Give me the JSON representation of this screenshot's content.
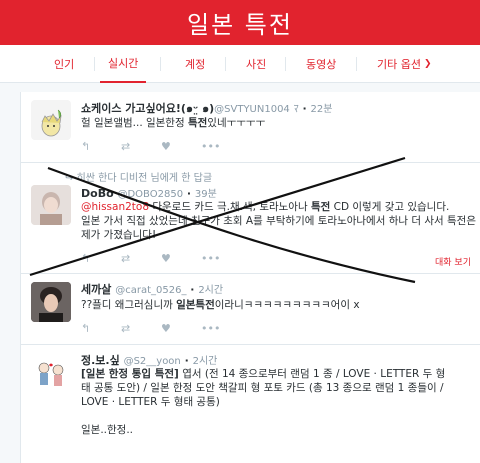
{
  "header": {
    "title": "일본 특전"
  },
  "tabs": [
    {
      "label": "인기"
    },
    {
      "label": "실시간"
    },
    {
      "label": "계정"
    },
    {
      "label": "사진"
    },
    {
      "label": "동영상"
    },
    {
      "label": "기타 옵션"
    }
  ],
  "tweets": [
    {
      "name": "쇼케이스 가고싶어요!(๑ᵕ̤ ๑)",
      "handle": "@SVTYUN1004",
      "suffix": "ﾏ",
      "time": "22분",
      "text_parts": [
        "헐 일본앨범... 일본한정 ",
        "특전",
        "있네ㅜㅜㅜㅜ"
      ]
    },
    {
      "context": "히싼 한다 디비전 님에게 한 답글",
      "name": "DoBo",
      "handle": "@DOBO2850",
      "time": "39분",
      "mention": "@hissan2to8",
      "text_rest_1": " 다운로드 카드 극.채.색, 토라노아나 ",
      "text_bold": "특전",
      "text_rest_2": " CD 이렇게 갖고 있습니다.",
      "text_line2": "일본 가서 직접 샀었는데 친구가 초회 A를 부탁하기에 토라노아나에서 하나 더 사서 특전은 제가 가졌습니다!",
      "conversation_link": "대화 보기"
    },
    {
      "name": "세까살",
      "handle": "@carat_0526_",
      "time": "2시간",
      "text_parts": [
        "??플디 왜그러심니까 ",
        "일본특전",
        "이라니ㅋㅋㅋㅋㅋㅋㅋㅋㅋ어이 x"
      ]
    },
    {
      "name": "정.보.싶",
      "handle": "@S2__yoon",
      "time": "2시간",
      "line1_bold": "[일본 한정 통입 특전]",
      "line1_rest": " 엽서 (전 14 종으로부터 랜덤 1 종 / LOVE · LETTER 두 형",
      "line2": "태 공통 도안) / 일본 한정 도안 책갈피 형 포토 카드 (총 13 종으로 랜덤 1 종들이 /",
      "line3": "LOVE · LETTER 두 형태 공통)",
      "line4": "일본..한정.."
    }
  ],
  "colors": {
    "accent": "#e1232e",
    "muted": "#8899a6"
  }
}
